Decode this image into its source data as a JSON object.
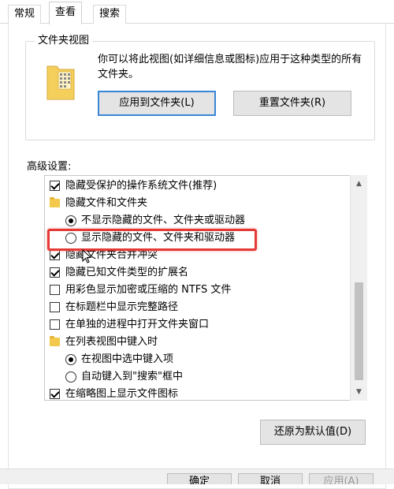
{
  "tabs": [
    {
      "label": "常规"
    },
    {
      "label": "查看"
    },
    {
      "label": "搜索"
    }
  ],
  "folder_views": {
    "title": "文件夹视图",
    "description": "你可以将此视图(如详细信息或图标)应用于这种类型的所有文件夹。",
    "apply_button": "应用到文件夹(L)",
    "reset_button": "重置文件夹(R)"
  },
  "advanced": {
    "label": "高级设置:",
    "items": [
      {
        "type": "checkbox",
        "checked": true,
        "label": "隐藏受保护的操作系统文件(推荐)"
      },
      {
        "type": "folder",
        "label": "隐藏文件和文件夹"
      },
      {
        "type": "radio",
        "selected": true,
        "label": "不显示隐藏的文件、文件夹或驱动器"
      },
      {
        "type": "radio",
        "selected": false,
        "label": "显示隐藏的文件、文件夹和驱动器"
      },
      {
        "type": "checkbox",
        "checked": true,
        "label": "隐藏文件夹合并冲突"
      },
      {
        "type": "checkbox",
        "checked": true,
        "label": "隐藏已知文件类型的扩展名"
      },
      {
        "type": "checkbox",
        "checked": false,
        "label": "用彩色显示加密或压缩的 NTFS 文件"
      },
      {
        "type": "checkbox",
        "checked": false,
        "label": "在标题栏中显示完整路径"
      },
      {
        "type": "checkbox",
        "checked": false,
        "label": "在单独的进程中打开文件夹窗口"
      },
      {
        "type": "folder",
        "label": "在列表视图中键入时"
      },
      {
        "type": "radio",
        "selected": true,
        "label": "在视图中选中键入项"
      },
      {
        "type": "radio",
        "selected": false,
        "label": "自动键入到\"搜索\"框中"
      },
      {
        "type": "checkbox",
        "checked": true,
        "label": "在缩略图上显示文件图标"
      }
    ]
  },
  "restore_defaults_button": "还原为默认值(D)",
  "footer_buttons": {
    "ok": "确定",
    "cancel": "取消",
    "apply": "应用(A)"
  },
  "highlight_color": "#e53935"
}
